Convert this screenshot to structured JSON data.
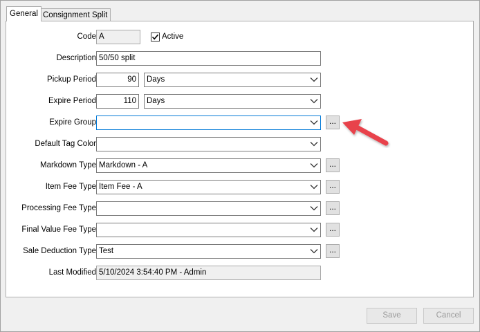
{
  "tabs": [
    {
      "label": "General"
    },
    {
      "label": "Consignment Split"
    }
  ],
  "form": {
    "code": {
      "label": "Code",
      "value": "A"
    },
    "active": {
      "label": "Active",
      "checked": true
    },
    "description": {
      "label": "Description",
      "value": "50/50 split"
    },
    "pickup_period": {
      "label": "Pickup Period",
      "value": "90",
      "unit": "Days"
    },
    "expire_period": {
      "label": "Expire Period",
      "value": "110",
      "unit": "Days"
    },
    "expire_group": {
      "label": "Expire Group",
      "value": ""
    },
    "default_tag_color": {
      "label": "Default Tag Color",
      "value": ""
    },
    "markdown_type": {
      "label": "Markdown Type",
      "value": "Markdown - A"
    },
    "item_fee_type": {
      "label": "Item Fee Type",
      "value": "Item Fee - A"
    },
    "processing_fee_type": {
      "label": "Processing Fee Type",
      "value": ""
    },
    "final_value_fee_type": {
      "label": "Final Value Fee Type",
      "value": ""
    },
    "sale_deduction_type": {
      "label": "Sale Deduction Type",
      "value": "Test"
    },
    "last_modified": {
      "label": "Last Modified",
      "value": "5/10/2024 3:54:40 PM - Admin"
    },
    "ellipsis_label": "..."
  },
  "buttons": {
    "save": "Save",
    "cancel": "Cancel"
  },
  "colors": {
    "annotation_arrow": "#e8434b",
    "focus_border": "#0078d7"
  }
}
